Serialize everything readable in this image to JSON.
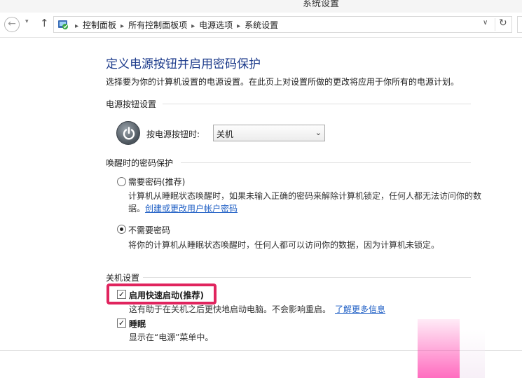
{
  "window": {
    "title": "系统设置"
  },
  "nav": {
    "back_glyph": "←",
    "recent_glyph": "▾",
    "up_glyph": "↑"
  },
  "address": {
    "crumbs": [
      "控制面板",
      "所有控制面板项",
      "电源选项",
      "系统设置"
    ],
    "separator": "▸",
    "dropdown_glyph": "∨",
    "refresh_glyph": "↻"
  },
  "page": {
    "title": "定义电源按钮并启用密码保护",
    "description": "选择要为你的计算机设置的电源设置。在此页上对设置所做的更改将应用于你所有的电源计划。"
  },
  "power_button": {
    "section": "电源按钮设置",
    "label": "按电源按钮时:",
    "selected": "关机",
    "arrow": "⌄"
  },
  "wake_password": {
    "section": "唤醒时的密码保护",
    "require": {
      "label": "需要密码(推荐)",
      "desc1": "计算机从睡眠状态唤醒时，如果未输入正确的密码来解除计算机锁定，任何人都无法访问你的数",
      "desc2_prefix": "据。",
      "link": "创建或更改用户帐户密码",
      "checked": false
    },
    "no_require": {
      "label": "不需要密码",
      "desc": "将你的计算机从睡眠状态唤醒时，任何人都可以访问你的数据，因为计算机未锁定。",
      "checked": true
    }
  },
  "shutdown": {
    "section": "关机设置",
    "fast_startup": {
      "label": "启用快速启动(推荐)",
      "desc_prefix": "这有助于在关机之后更快地启动电脑。不会影响重启。",
      "link": "了解更多信息",
      "checked": true
    },
    "sleep": {
      "label": "睡眠",
      "desc": "显示在“电源”菜单中。",
      "checked": true
    },
    "check_glyph": "✓"
  },
  "colors": {
    "title": "#1e3c8c",
    "link": "#1f5fc5",
    "highlight": "#e0245e"
  }
}
